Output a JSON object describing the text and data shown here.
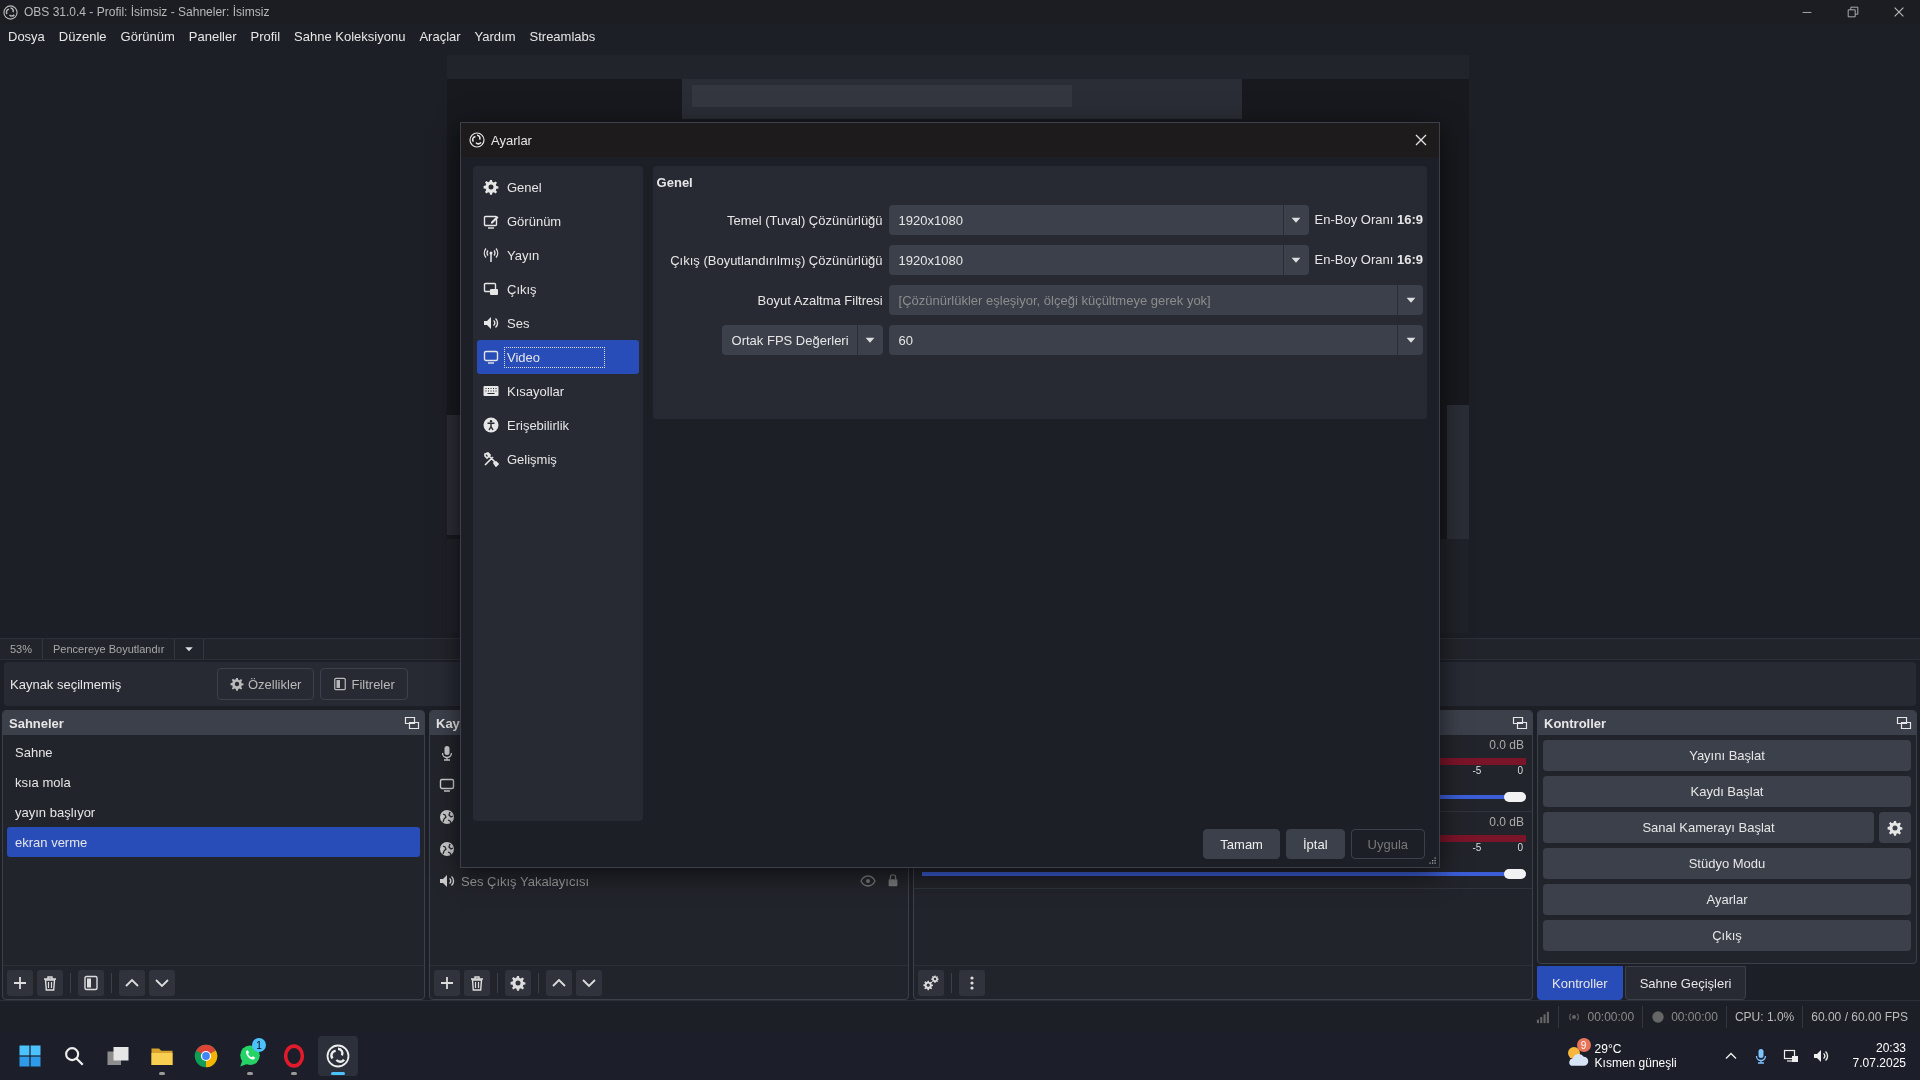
{
  "window": {
    "title": "OBS 31.0.4 - Profil: İsimsiz - Sahneler: İsimsiz"
  },
  "menu": [
    "Dosya",
    "Düzenle",
    "Görünüm",
    "Paneller",
    "Profil",
    "Sahne Koleksiyonu",
    "Araçlar",
    "Yardım",
    "Streamlabs"
  ],
  "preview_bar": {
    "zoom": "53%",
    "mode": "Pencereye Boyutlandır"
  },
  "source_toolbar": {
    "status": "Kaynak seçilmemiş",
    "buttons": [
      "Özellikler",
      "Filtreler"
    ]
  },
  "scenes": {
    "title": "Sahneler",
    "items": [
      {
        "label": "Sahne",
        "selected": false
      },
      {
        "label": "ksıa mola",
        "selected": false
      },
      {
        "label": "yayın başlıyor",
        "selected": false
      },
      {
        "label": "ekran verme",
        "selected": true
      }
    ]
  },
  "sources": {
    "title": "Kay",
    "items": [
      {
        "kind": "mic"
      },
      {
        "kind": "display"
      },
      {
        "kind": "browser"
      },
      {
        "kind": "browser"
      },
      {
        "kind": "audio",
        "label": "Ses Çıkış Yakalayıcısı"
      }
    ]
  },
  "mixer": {
    "channels": [
      {
        "reading": "0.0 dB",
        "ticks": [
          "-5",
          "0"
        ],
        "level": 1
      },
      {
        "reading": "0.0 dB",
        "ticks": [
          "-5",
          "0"
        ],
        "level": 1
      }
    ]
  },
  "controls": {
    "title": "Kontroller",
    "buttons": [
      {
        "label": "Yayını Başlat",
        "kind": "plain"
      },
      {
        "label": "Kaydı Başlat",
        "kind": "plain"
      },
      {
        "label": "Sanal Kamerayı Başlat",
        "kind": "split"
      },
      {
        "label": "Stüdyo Modu",
        "kind": "plain"
      },
      {
        "label": "Ayarlar",
        "kind": "plain"
      },
      {
        "label": "Çıkış",
        "kind": "plain"
      }
    ]
  },
  "dock_tabs": [
    {
      "label": "Kontroller",
      "selected": true
    },
    {
      "label": "Sahne Geçişleri",
      "selected": false
    }
  ],
  "status_bar": {
    "stream_time": "00:00:00",
    "record_time": "00:00:00",
    "cpu": "CPU: 1.0%",
    "fps": "60.00 / 60.00 FPS"
  },
  "settings": {
    "title": "Ayarlar",
    "categories": [
      {
        "label": "Genel",
        "selected": false
      },
      {
        "label": "Görünüm",
        "selected": false
      },
      {
        "label": "Yayın",
        "selected": false
      },
      {
        "label": "Çıkış",
        "selected": false
      },
      {
        "label": "Ses",
        "selected": false
      },
      {
        "label": "Video",
        "selected": true
      },
      {
        "label": "Kısayollar",
        "selected": false
      },
      {
        "label": "Erişebilirlik",
        "selected": false
      },
      {
        "label": "Gelişmiş",
        "selected": false
      }
    ],
    "group": "Genel",
    "rows": [
      {
        "kind": "combo",
        "label": "Temel (Tuval) Çözünürlüğü",
        "value": "1920x1080",
        "note": "En-Boy Oranı **16:9**",
        "disabled": false
      },
      {
        "kind": "combo",
        "label": "Çıkış (Boyutlandırılmış) Çözünürlüğü",
        "value": "1920x1080",
        "note": "En-Boy Oranı **16:9**",
        "disabled": false
      },
      {
        "kind": "combo",
        "label": "Boyut Azaltma Filtresi",
        "value": "[Çözünürlükler eşleşiyor, ölçeği küçültmeye gerek yok]",
        "disabled": true
      },
      {
        "kind": "fps",
        "mode": "Ortak FPS Değerleri",
        "value": "60",
        "disabled": false
      }
    ],
    "buttons": [
      {
        "label": "Tamam",
        "disabled": false
      },
      {
        "label": "İptal",
        "disabled": false
      },
      {
        "label": "Uygula",
        "disabled": true
      }
    ]
  },
  "taskbar": {
    "apps": [
      {
        "kind": "start",
        "running": false,
        "active": false
      },
      {
        "kind": "search",
        "running": false,
        "active": false
      },
      {
        "kind": "taskview",
        "running": false,
        "active": false
      },
      {
        "kind": "explorer",
        "running": true,
        "active": false
      },
      {
        "kind": "browser",
        "running": false,
        "active": false
      },
      {
        "kind": "chat",
        "running": true,
        "active": false,
        "badge": "1"
      },
      {
        "kind": "opera",
        "running": true,
        "active": false
      },
      {
        "kind": "obs",
        "running": true,
        "active": true
      }
    ],
    "weather": {
      "badge": "9",
      "temperature": "29°C",
      "condition": "Kısmen güneşli"
    },
    "time": "20:33",
    "date": "7.07.2025"
  }
}
